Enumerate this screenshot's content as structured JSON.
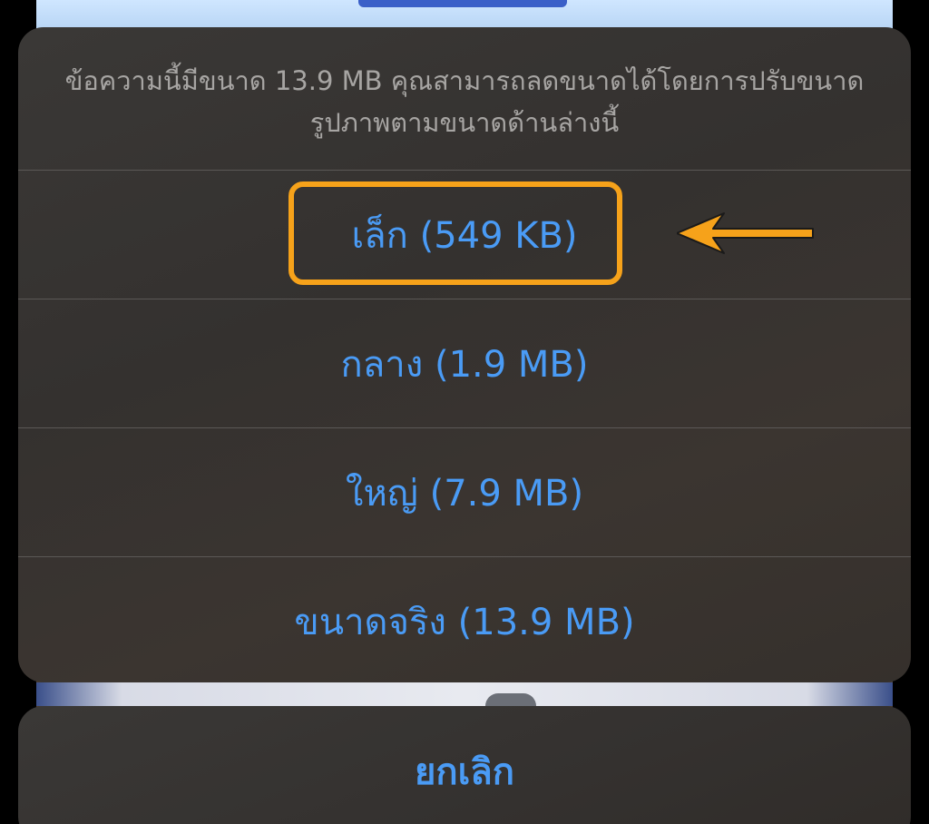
{
  "sheet": {
    "message_line1": "ข้อความนี้มีขนาด 13.9 MB คุณสามารถลดขนาดได้โดยการปรับขนาด",
    "message_line2": "รูปภาพตามขนาดด้านล่างนี้",
    "options": [
      {
        "label": "เล็ก (549 KB)",
        "highlighted": true
      },
      {
        "label": "กลาง (1.9 MB)",
        "highlighted": false
      },
      {
        "label": "ใหญ่ (7.9 MB)",
        "highlighted": false
      },
      {
        "label": "ขนาดจริง (13.9 MB)",
        "highlighted": false
      }
    ]
  },
  "cancel_label": "ยกเลิก",
  "colors": {
    "accent": "#4a9bf5",
    "highlight": "#f6a21a",
    "sheet_bg": "#363331",
    "message_text": "#a7a5a3"
  }
}
